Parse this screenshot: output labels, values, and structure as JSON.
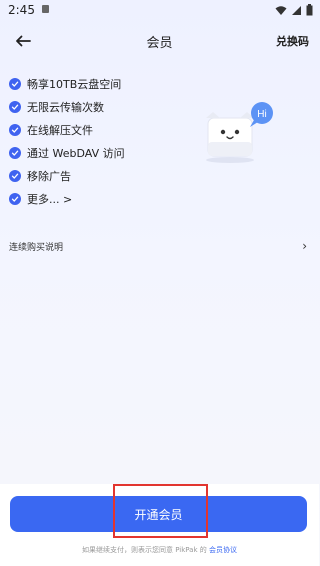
{
  "status_bar": {
    "time": "2:45"
  },
  "header": {
    "back_icon": "arrow-left-icon",
    "title": "会员",
    "redeem_label": "兑换码"
  },
  "benefits": [
    {
      "label": "畅享10TB云盘空间"
    },
    {
      "label": "无限云传输次数"
    },
    {
      "label": "在线解压文件"
    },
    {
      "label": "通过 WebDAV 访问"
    },
    {
      "label": "移除广告"
    },
    {
      "label": "更多... >"
    }
  ],
  "mascot": {
    "bubble_text": "Hi"
  },
  "renewal": {
    "label": "连续购买说明",
    "arrow": "›"
  },
  "cta": {
    "label": "开通会员"
  },
  "agreement": {
    "prefix": "如果继续支付，则表示您同意 PikPak 的",
    "link": "会员协议"
  },
  "colors": {
    "accent": "#3a68f2",
    "highlight": "#e2352f",
    "check": "#3f63f0"
  }
}
